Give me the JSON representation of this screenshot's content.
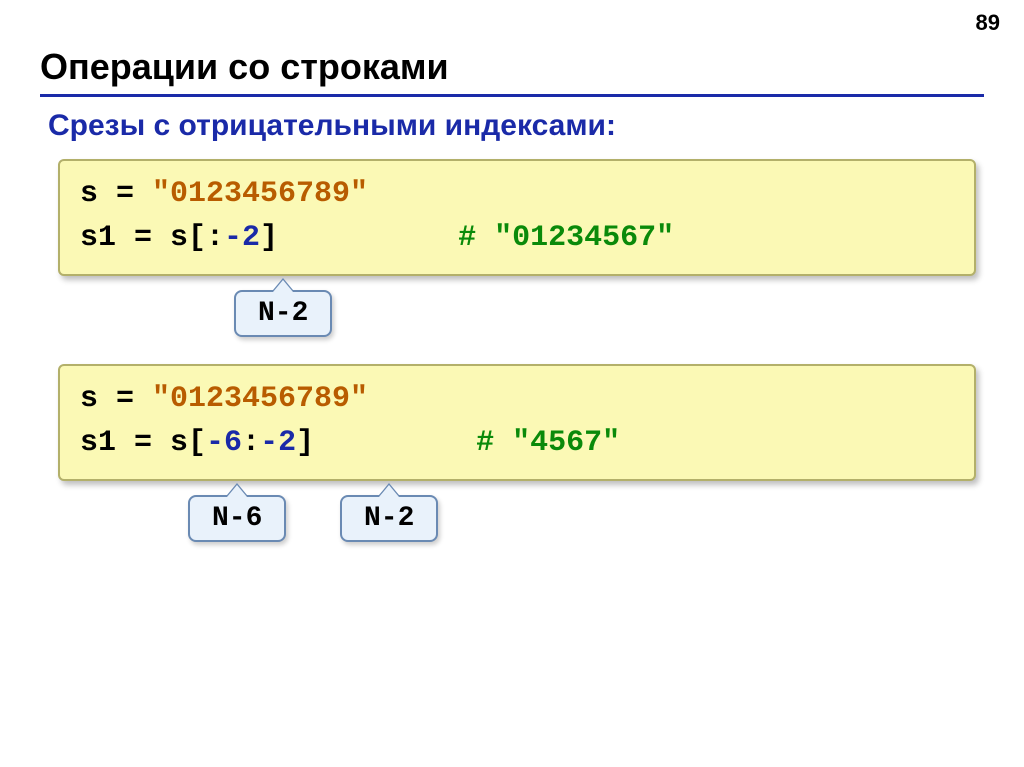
{
  "page_number": "89",
  "title": "Операции со строками",
  "subtitle": "Срезы с отрицательными индексами:",
  "example1": {
    "l1_left": "s = ",
    "l1_str": "\"0123456789\"",
    "l2_left": "s1 = s[:",
    "l2_num": "-2",
    "l2_right": "]",
    "l2_pad": "          ",
    "l2_cmt": "# \"01234567\"",
    "callout1": "N-2"
  },
  "example2": {
    "l1_left": "s = ",
    "l1_str": "\"0123456789\"",
    "l2_left": "s1 = s[",
    "l2_n1": "-6",
    "l2_mid": ":",
    "l2_n2": "-2",
    "l2_right": "]",
    "l2_pad": "         ",
    "l2_cmt": "# \"4567\"",
    "callout1": "N-6",
    "callout2": "N-2"
  }
}
